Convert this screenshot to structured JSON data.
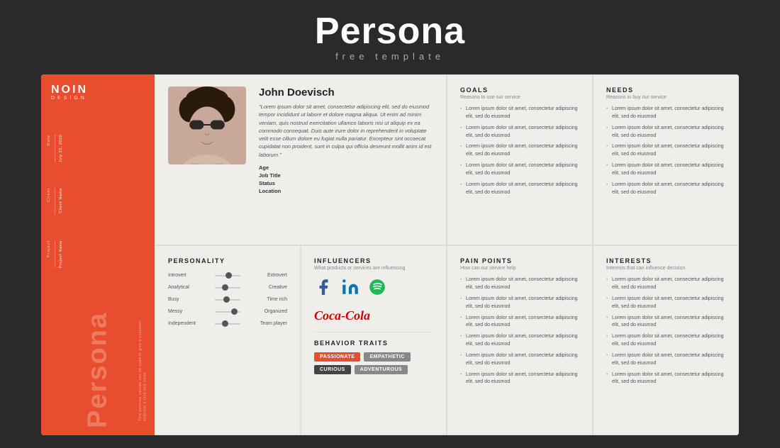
{
  "header": {
    "title": "Persona",
    "subtitle": "free template"
  },
  "sidebar": {
    "brand": "NOIN",
    "brand_sub": "DESIGN",
    "date_label": "Date",
    "date_value": "July 23, 2020",
    "client_label": "Client",
    "client_value": "Client Name",
    "project_label": "Project",
    "project_value": "Project Name",
    "persona_big": "Persona",
    "persona_desc": "This persona canvas can be used to give a customer segment a face and name"
  },
  "profile": {
    "name": "John Doevisch",
    "quote": "\"Lorem ipsum dolor sit amet, consectetur adipiscing elit, sed do eiusmod tempor incididunt ut labore et dolore magna aliqua. Ut enim ad minim veniam, quis nostrud exercitation ullamco laboris nisi ut aliquip ex ea commodo consequat. Duis aute irure dolor in reprehenderit in voluptate velit esse cillum dolore eu fugiat nulla pariatur. Excepteur sint occaecat cupidatat non proident, sunt in culpa qui officia deserunt mollit anim id est laborum.\"",
    "age_label": "Age",
    "job_label": "Job Title",
    "status_label": "Status",
    "location_label": "Location"
  },
  "goals": {
    "title": "GOALS",
    "subtitle": "Reasons to use our service",
    "items": [
      "Lorem ipsum dolor sit amet, consectetur adipiscing elit, sed do eiusmod",
      "Lorem ipsum dolor sit amet, consectetur adipiscing elit, sed do eiusmod",
      "Lorem ipsum dolor sit amet, consectetur adipiscing elit, sed do eiusmod",
      "Lorem ipsum dolor sit amet, consectetur adipiscing elit, sed do eiusmod",
      "Lorem ipsum dolor sit amet, consectetur adipiscing elit, sed do eiusmod"
    ]
  },
  "needs": {
    "title": "NEEDS",
    "subtitle": "Reasons to buy our service",
    "items": [
      "Lorem ipsum dolor sit amet, consectetur adipiscing elit, sed do eiusmod",
      "Lorem ipsum dolor sit amet, consectetur adipiscing elit, sed do eiusmod",
      "Lorem ipsum dolor sit amet, consectetur adipiscing elit, sed do eiusmod",
      "Lorem ipsum dolor sit amet, consectetur adipiscing elit, sed do eiusmod",
      "Lorem ipsum dolor sit amet, consectetur adipiscing elit, sed do eiusmod"
    ]
  },
  "personality": {
    "title": "PERSONALITY",
    "sliders": [
      {
        "left": "Introvert",
        "right": "Extrovert",
        "position": 0.45
      },
      {
        "left": "Analytical",
        "right": "Creative",
        "position": 0.3
      },
      {
        "left": "Busy",
        "right": "Time rich",
        "position": 0.35
      },
      {
        "left": "Messy",
        "right": "Organized",
        "position": 0.65
      },
      {
        "left": "Independent",
        "right": "Team player",
        "position": 0.3
      }
    ]
  },
  "influencers": {
    "title": "INFLUENCERS",
    "subtitle": "What products or services are influencing"
  },
  "behavior_traits": {
    "title": "BEHAVIOR TRAITS",
    "tags": [
      {
        "label": "PASSIONATE",
        "color": "orange"
      },
      {
        "label": "EMPATHETIC",
        "color": "gray"
      },
      {
        "label": "CURIOUS",
        "color": "dark"
      },
      {
        "label": "ADVENTUROUS",
        "color": "gray"
      }
    ]
  },
  "pain_points": {
    "title": "PAIN POINTS",
    "subtitle": "How can our service help",
    "items": [
      "Lorem ipsum dolor sit amet, consectetur adipiscing elit, sed do eiusmod",
      "Lorem ipsum dolor sit amet, consectetur adipiscing elit, sed do eiusmod",
      "Lorem ipsum dolor sit amet, consectetur adipiscing elit, sed do eiusmod",
      "Lorem ipsum dolor sit amet, consectetur adipiscing elit, sed do eiusmod",
      "Lorem ipsum dolor sit amet, consectetur adipiscing elit, sed do eiusmod",
      "Lorem ipsum dolor sit amet, consectetur adipiscing elit, sed do eiusmod"
    ]
  },
  "interests": {
    "title": "INTERESTS",
    "subtitle": "Interests that can influence decision",
    "items": [
      "Lorem ipsum dolor sit amet, consectetur adipiscing elit, sed do eiusmod",
      "Lorem ipsum dolor sit amet, consectetur adipiscing elit, sed do eiusmod",
      "Lorem ipsum dolor sit amet, consectetur adipiscing elit, sed do eiusmod",
      "Lorem ipsum dolor sit amet, consectetur adipiscing elit, sed do eiusmod",
      "Lorem ipsum dolor sit amet, consectetur adipiscing elit, sed do eiusmod",
      "Lorem ipsum dolor sit amet, consectetur adipiscing elit, sed do eiusmod"
    ]
  }
}
